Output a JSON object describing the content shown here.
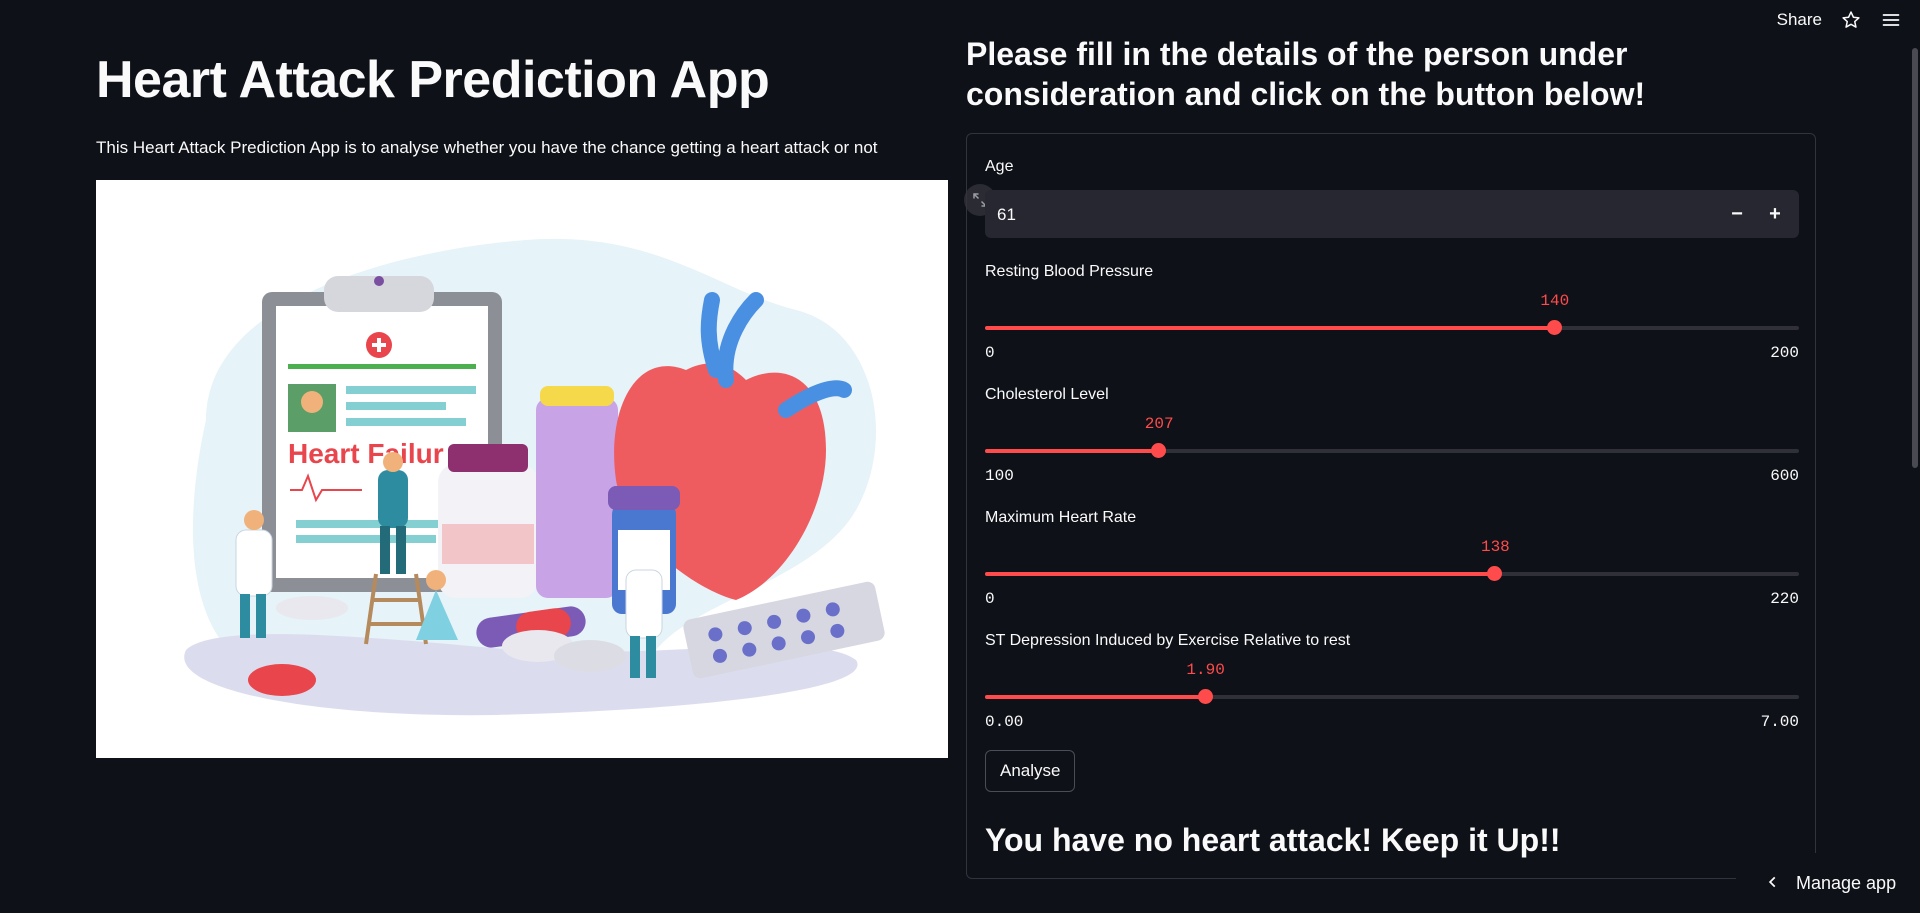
{
  "toolbar": {
    "share_label": "Share",
    "star_icon": "star-icon",
    "menu_icon": "hamburger-menu-icon"
  },
  "left": {
    "title": "Heart Attack Prediction App",
    "description": "This Heart Attack Prediction App is to analyse whether you have the chance getting a heart attack or not",
    "image_caption_text": "Heart Failur"
  },
  "right": {
    "heading": "Please fill in the details of the person under consideration and click on the button below!",
    "age": {
      "label": "Age",
      "value": "61",
      "minus": "−",
      "plus": "+"
    },
    "sliders": [
      {
        "label": "Resting Blood Pressure",
        "value": "140",
        "min": "0",
        "max": "200",
        "fraction": 0.7
      },
      {
        "label": "Cholesterol Level",
        "value": "207",
        "min": "100",
        "max": "600",
        "fraction": 0.214
      },
      {
        "label": "Maximum Heart Rate",
        "value": "138",
        "min": "0",
        "max": "220",
        "fraction": 0.627
      },
      {
        "label": "ST Depression Induced by Exercise Relative to rest",
        "value": "1.90",
        "min": "0.00",
        "max": "7.00",
        "fraction": 0.271
      }
    ],
    "analyse_label": "Analyse",
    "result_text": "You have no heart attack! Keep it Up!!"
  },
  "footer": {
    "manage_label": "Manage app"
  },
  "colors": {
    "accent": "#ff4b4b",
    "background": "#0e1117",
    "input_bg": "#262730"
  }
}
